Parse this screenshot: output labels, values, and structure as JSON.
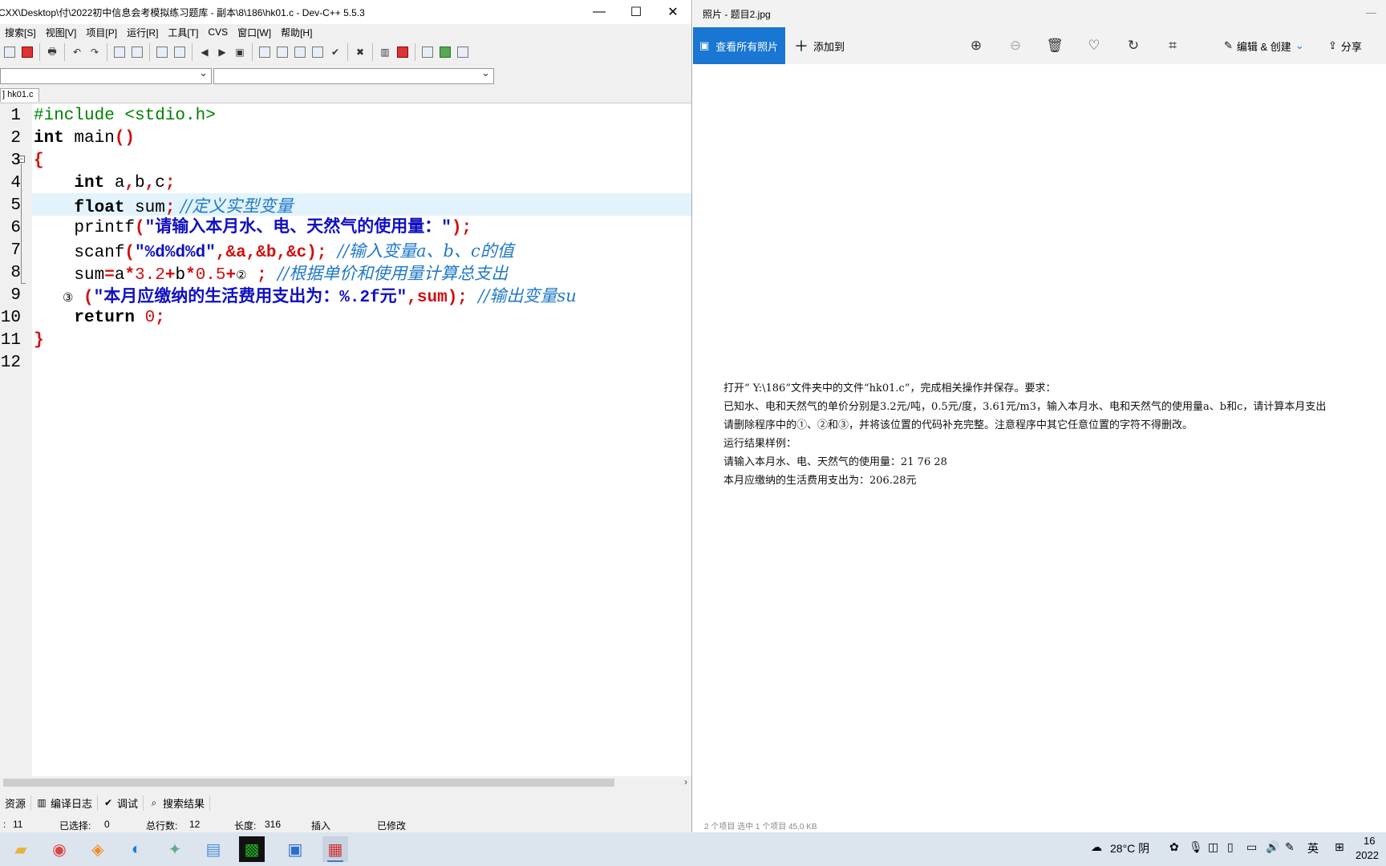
{
  "ide": {
    "title": "CXX\\Desktop\\付\\2022初中信息会考模拟练习题库 - 副本\\8\\186\\hk01.c - Dev-C++ 5.5.3",
    "window_buttons": {
      "min": "—",
      "max": "☐",
      "close": "✕"
    },
    "menu": [
      "搜索[S]",
      "视图[V]",
      "项目[P]",
      "运行[R]",
      "工具[T]",
      "CVS",
      "窗口[W]",
      "帮助[H]"
    ],
    "tab": "] hk01.c",
    "line_numbers": [
      "1",
      "2",
      "3",
      "4",
      "5",
      "6",
      "7",
      "8",
      "9",
      "10",
      "11",
      "12"
    ],
    "code": {
      "l1": "#include <stdio.h>",
      "l2_kw": "int",
      "l2_id": " main",
      "l2_br": "()",
      "l3": "{",
      "l4_kw": "    int",
      "l4_id": " a",
      "l4_c1": ",",
      "l4_b": "b",
      "l4_c2": ",",
      "l4_c": "c",
      "l4_sc": ";",
      "l5_kw": "    float",
      "l5_id": " sum",
      "l5_sc": ";",
      "l5_cm": " //定义实型变量",
      "l6_id": "    printf",
      "l6_p": "(",
      "l6_st": "\"请输入本月水、电、天然气的使用量：\"",
      "l6_end": ");",
      "l7_id": "    scanf",
      "l7_p": "(",
      "l7_st": "\"%d%d%d\"",
      "l7_rest": ",&a,&b,&c);",
      "l7_cm": "  //输入变量a、b、c的值",
      "l8_a": "    sum",
      "l8_eq": "=",
      "l8_b": "a",
      "l8_op1": "*",
      "l8_n1": "3.2",
      "l8_op2": "+",
      "l8_c": "b",
      "l8_op3": "*",
      "l8_n2": "0.5",
      "l8_op4": "+",
      "l8_circ": "②",
      "l8_sc": " ;",
      "l8_cm": "  //根据单价和使用量计算总支出",
      "l9_circ": "    ③",
      "l9_p": " (",
      "l9_st": "\"本月应缴纳的生活费用支出为：%.2f元\"",
      "l9_rest": ",sum);",
      "l9_cm": "  //输出变量su",
      "l10_kw": "    return",
      "l10_n": " 0",
      "l10_sc": ";",
      "l11": "}"
    },
    "bottom_tabs": [
      "资源",
      "编译日志",
      "调试",
      "搜索结果"
    ],
    "status": {
      "line": "11",
      "selected_label": "已选择:",
      "selected_value": "0",
      "total_label": "总行数:",
      "total_value": "12",
      "length_label": "长度:",
      "length_value": "316",
      "mode": "插入",
      "modified": "已修改"
    }
  },
  "photos": {
    "title": "照片 - 题目2.jpg",
    "view_all": "查看所有照片",
    "add_to": "添加到",
    "edit_create": "编辑 & 创建",
    "share": "分享",
    "question": [
      "打开“ Y:\\186”文件夹中的文件“hk01.c”，完成相关操作并保存。要求：",
      "已知水、电和天然气的单价分别是3.2元/吨，0.5元/度，3.61元/m3，输入本月水、电和天然气的使用量a、b和c，请计算本月支出",
      "请删除程序中的①、②和③，并将该位置的代码补充完整。注意程序中其它任意位置的字符不得删改。",
      "运行结果样例：",
      "请输入本月水、电、天然气的使用量：21  76  28",
      "本月应缴纳的生活费用支出为：206.28元"
    ],
    "footer": "2 个项目    选中 1 个项目  45.0 KB"
  },
  "taskbar": {
    "weather": "28°C 阴",
    "ime": "英",
    "clock_time": "16",
    "clock_date": "2022"
  },
  "colors": {
    "accent": "#1976d2",
    "preprocessor": "#008000",
    "string": "#1010c0",
    "comment": "#1f78c8",
    "number_symbol": "#d01010",
    "current_line": "#e2f3fb"
  }
}
